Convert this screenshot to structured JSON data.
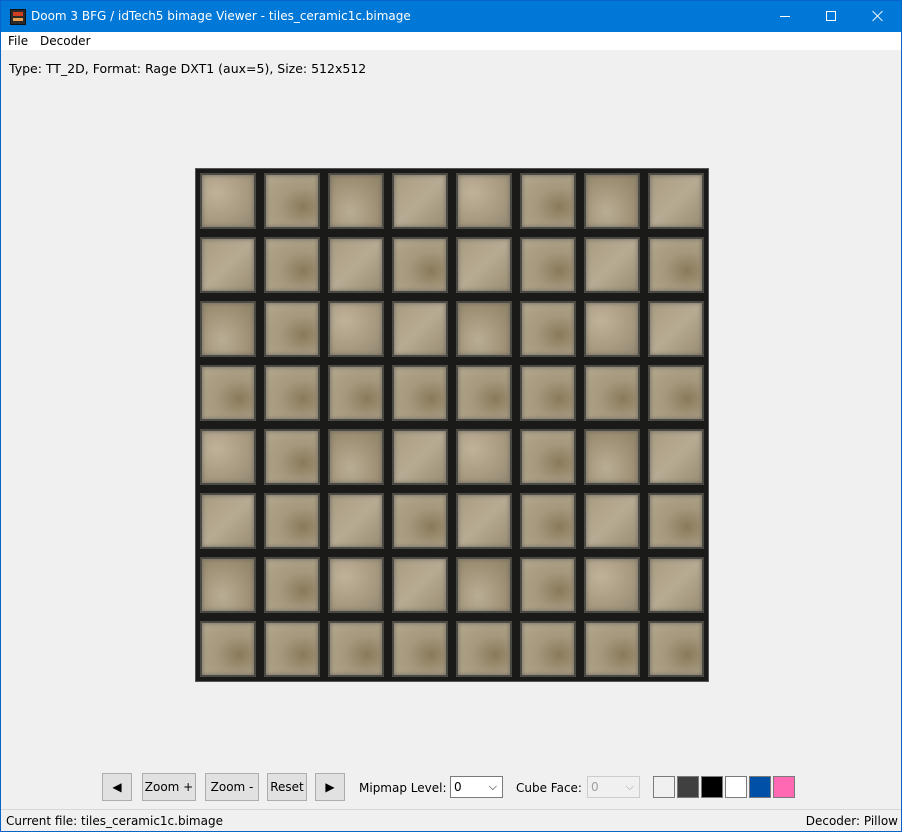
{
  "window": {
    "title": "Doom 3 BFG / idTech5 bimage Viewer - tiles_ceramic1c.bimage",
    "icon": "doom-app-icon"
  },
  "menu": {
    "file": "File",
    "decoder": "Decoder"
  },
  "info_line": "Type: TT_2D, Format: Rage DXT1 (aux=5), Size: 512x512",
  "toolbar": {
    "prev": "◀",
    "zoom_in": "Zoom +",
    "zoom_out": "Zoom -",
    "reset": "Reset",
    "next": "▶",
    "mipmap_label": "Mipmap Level:",
    "mipmap_value": "0",
    "cube_face_label": "Cube Face:",
    "cube_face_value": "0",
    "swatches": [
      "#f0f0f0",
      "#404040",
      "#000000",
      "#ffffff",
      "#0050a8",
      "#ff69b4"
    ]
  },
  "status": {
    "current_file": "Current file: tiles_ceramic1c.bimage",
    "decoder": "Decoder: Pillow"
  }
}
